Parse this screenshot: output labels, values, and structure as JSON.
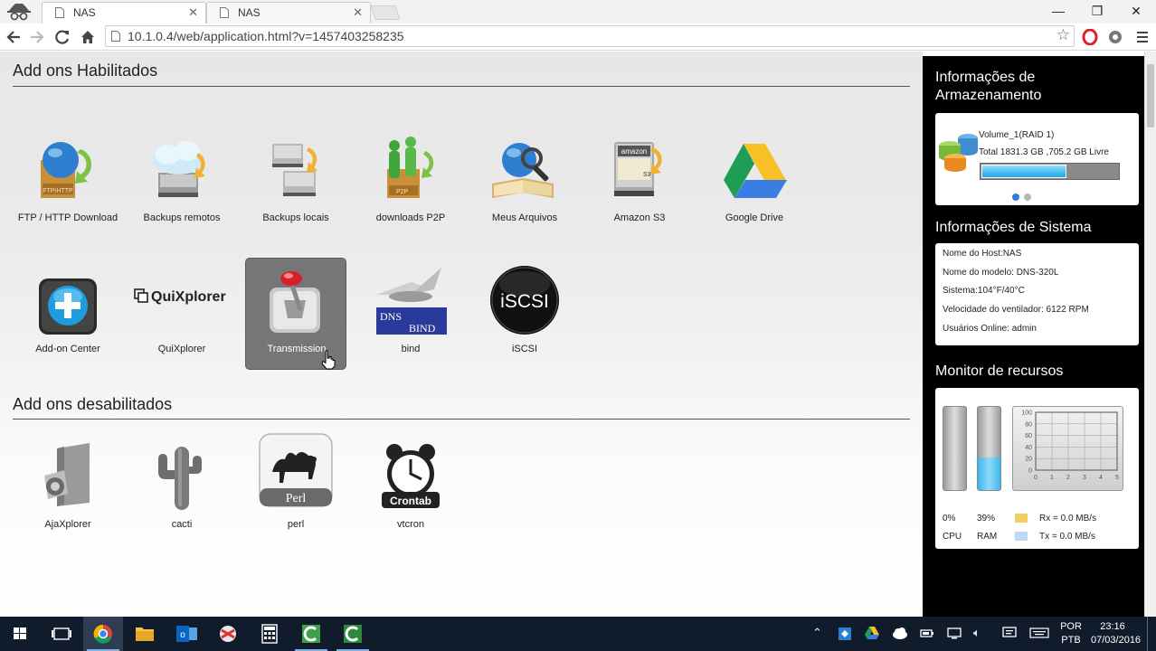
{
  "browser": {
    "tabs": [
      {
        "title": "NAS",
        "active": true
      },
      {
        "title": "NAS",
        "active": false
      }
    ],
    "url": "10.1.0.4/web/application.html?v=1457403258235",
    "window_controls": {
      "minimize": "—",
      "restore": "❐",
      "close": "✕"
    }
  },
  "enabled_section": {
    "title": "Add ons Habilitados",
    "addons": [
      {
        "label": "FTP / HTTP Download",
        "icon": "ftp-globe-icon"
      },
      {
        "label": "Backups remotos",
        "icon": "cloud-backup-icon"
      },
      {
        "label": "Backups locais",
        "icon": "local-backup-icon"
      },
      {
        "label": "downloads P2P",
        "icon": "p2p-icon"
      },
      {
        "label": "Meus Arquivos",
        "icon": "globe-magnifier-icon"
      },
      {
        "label": "Amazon S3",
        "icon": "amazon-s3-icon",
        "icon_text": "amazon",
        "icon_badge": "S3"
      },
      {
        "label": "Google Drive",
        "icon": "google-drive-icon"
      },
      {
        "label": "Add-on Center",
        "icon": "add-on-center-icon"
      },
      {
        "label": "QuiXplorer",
        "icon": "quixplorer-logo",
        "icon_text": "QuiXplorer"
      },
      {
        "label": "Transmission",
        "icon": "transmission-icon",
        "hovered": true
      },
      {
        "label": "bind",
        "icon": "dns-bind-icon",
        "icon_text_1": "DNS",
        "icon_text_2": "BIND"
      },
      {
        "label": "iSCSI",
        "icon": "iscsi-icon",
        "icon_text": "iSCSI"
      }
    ]
  },
  "disabled_section": {
    "title": "Add ons desabilitados",
    "addons": [
      {
        "label": "AjaXplorer",
        "icon": "ajaxplorer-icon"
      },
      {
        "label": "cacti",
        "icon": "cactus-icon"
      },
      {
        "label": "perl",
        "icon": "perl-camel-icon",
        "icon_text": "Perl"
      },
      {
        "label": "vtcron",
        "icon": "crontab-clock-icon",
        "icon_text": "Crontab"
      }
    ]
  },
  "storage_info": {
    "title": "Informações de Armazenamento",
    "volume_name": "Volume_1(RAID 1)",
    "volume_detail": "Total 1831.3 GB ,705.2 GB Livre",
    "used_fraction": 0.615
  },
  "system_info": {
    "title": "Informações de Sistema",
    "lines": [
      "Nome do Host:NAS",
      "Nome do modelo: DNS-320L",
      "Sistema:104°F/40°C",
      "Velocidade do ventilador: 6122 RPM",
      "Usuários Online: admin"
    ]
  },
  "resource_monitor": {
    "title": "Monitor de recursos",
    "cpu_value": "0%",
    "cpu_label": "CPU",
    "cpu_fraction": 0.0,
    "ram_value": "39%",
    "ram_label": "RAM",
    "ram_fraction": 0.39,
    "rx": "Rx = 0.0 MB/s",
    "tx": "Tx = 0.0 MB/s",
    "rx_color": "#f0d060",
    "tx_color": "#bcd8f4",
    "graph_y_ticks": [
      "100",
      "80",
      "60",
      "40",
      "20",
      "0"
    ],
    "graph_x_ticks": [
      "0",
      "1",
      "2",
      "3",
      "4",
      "5"
    ]
  },
  "taskbar": {
    "lang_1": "POR",
    "lang_2": "PTB",
    "time": "23:16",
    "date": "07/03/2016"
  },
  "colors": {
    "accent_blue": "#47c1f0",
    "sidebar_bg": "#000000",
    "taskbar_bg": "#101c2c"
  }
}
